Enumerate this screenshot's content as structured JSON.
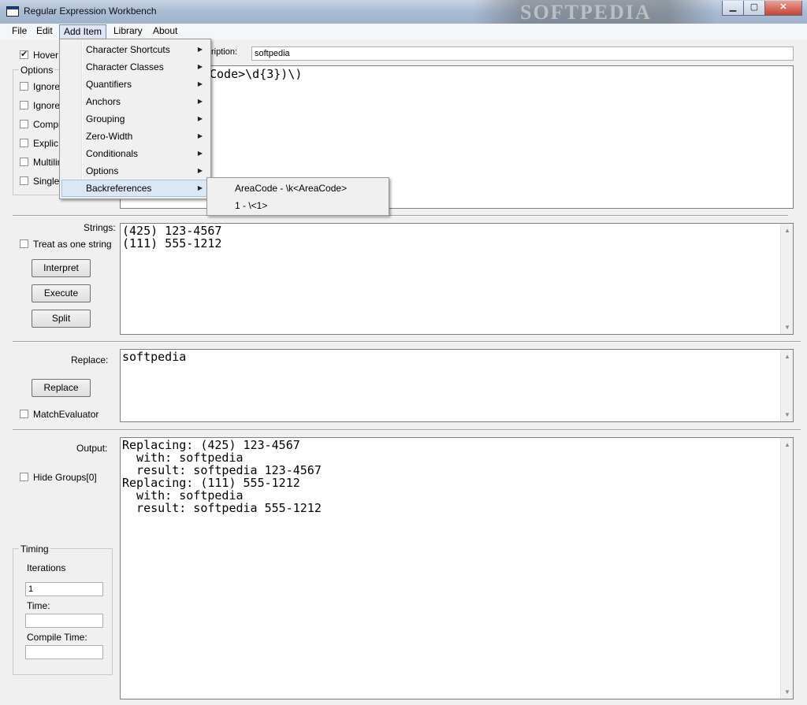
{
  "window": {
    "title": "Regular Expression Workbench",
    "watermark": "SOFTPEDIA"
  },
  "caption_buttons": {
    "minimize": "▁",
    "maximize": "▢",
    "close": "✕"
  },
  "menubar": {
    "items": [
      "File",
      "Edit",
      "Add Item",
      "Library",
      "About"
    ],
    "active": "Add Item"
  },
  "top": {
    "hover_label": "Hover",
    "hover_checked": true,
    "description_label": "ription:",
    "description_value": "softpedia",
    "regex_text": "Code>\\d{3})\\)"
  },
  "options": {
    "title": "Options",
    "items": [
      {
        "label": "IgnoreW",
        "checked": false
      },
      {
        "label": "Ignore",
        "checked": false
      },
      {
        "label": "Compi",
        "checked": false
      },
      {
        "label": "Explic",
        "checked": false
      },
      {
        "label": "Multilin",
        "checked": false
      },
      {
        "label": "Single",
        "checked": false
      }
    ]
  },
  "add_item_menu": {
    "items": [
      {
        "label": "Character Shortcuts"
      },
      {
        "label": "Character Classes"
      },
      {
        "label": "Quantifiers"
      },
      {
        "label": "Anchors"
      },
      {
        "label": "Grouping"
      },
      {
        "label": "Zero-Width"
      },
      {
        "label": "Conditionals"
      },
      {
        "label": "Options"
      },
      {
        "label": "Backreferences"
      }
    ],
    "highlighted": "Backreferences",
    "submenu": [
      "AreaCode - \\k<AreaCode>",
      "1 - \\<1>"
    ]
  },
  "strings": {
    "label": "Strings:",
    "treat_as_one": "Treat as one string",
    "treat_checked": false,
    "buttons": {
      "interpret": "Interpret",
      "execute": "Execute",
      "split": "Split"
    },
    "text": "(425) 123-4567\n(111) 555-1212"
  },
  "replace": {
    "label": "Replace:",
    "button": "Replace",
    "match_evaluator": "MatchEvaluator",
    "match_checked": false,
    "text": "softpedia"
  },
  "output": {
    "label": "Output:",
    "hide_groups": "Hide Groups[0]",
    "hide_checked": false,
    "text": "Replacing: (425) 123-4567\n  with: softpedia\n  result: softpedia 123-4567\nReplacing: (111) 555-1212\n  with: softpedia\n  result: softpedia 555-1212"
  },
  "timing": {
    "title": "Timing",
    "iterations_label": "Iterations",
    "iterations_value": "1",
    "time_label": "Time:",
    "time_value": "",
    "compile_label": "Compile Time:",
    "compile_value": ""
  }
}
